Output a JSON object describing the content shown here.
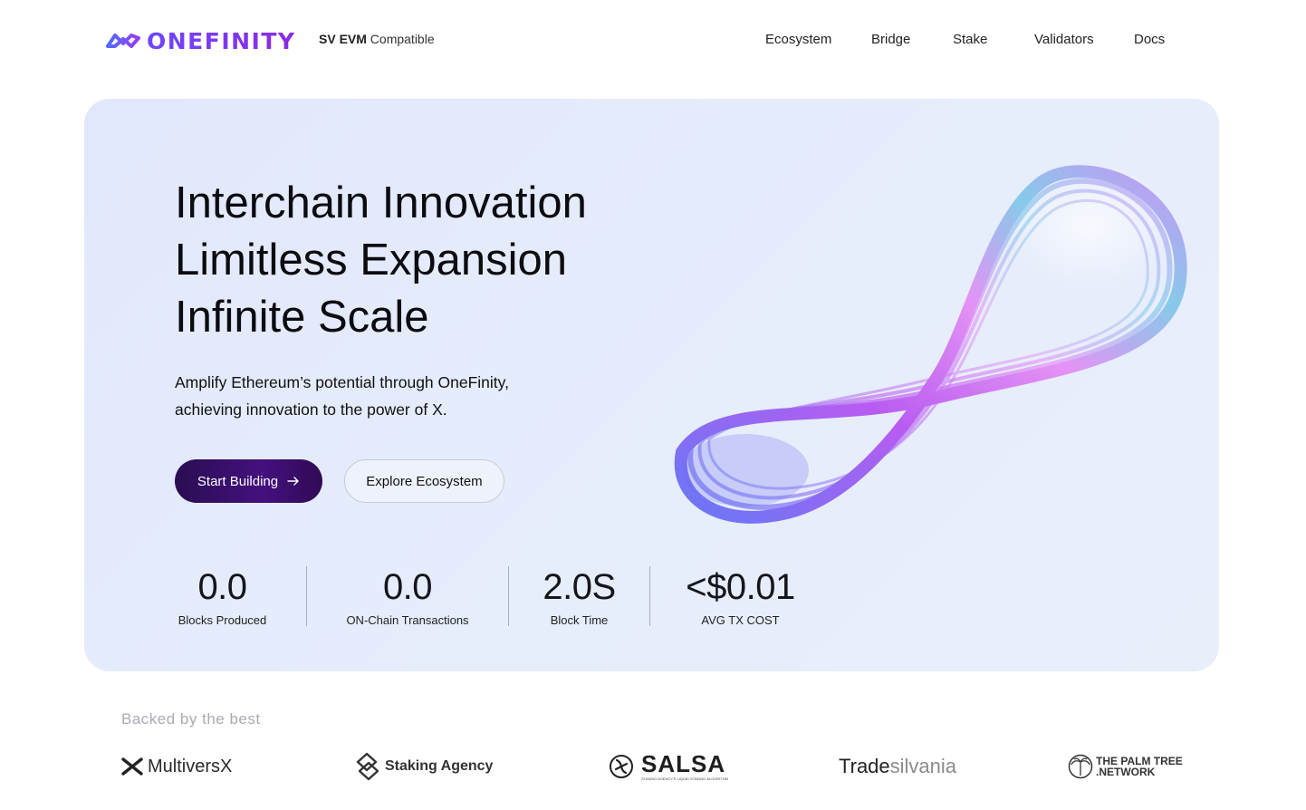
{
  "header": {
    "logo_text": "ONEFINITY",
    "tag_bold": "SV EVM",
    "tag_rest": "Compatible",
    "nav": [
      "Ecosystem",
      "Bridge",
      "Stake",
      "Validators",
      "Docs"
    ]
  },
  "hero": {
    "headline": [
      "Interchain Innovation",
      "Limitless Expansion",
      "Infinite Scale"
    ],
    "subtext_line1": "Amplify Ethereum’s potential through OneFinity,",
    "subtext_line2": "achieving innovation to the power of X.",
    "primary_button": "Start Building",
    "secondary_button": "Explore Ecosystem",
    "stats": [
      {
        "value": "0.0",
        "label": "Blocks Produced"
      },
      {
        "value": "0.0",
        "label": "ON-Chain Transactions"
      },
      {
        "value": "2.0S",
        "label": "Block Time"
      },
      {
        "value": "<$0.01",
        "label": "AVG TX COST"
      }
    ]
  },
  "backers": {
    "title": "Backed by the best",
    "partners": [
      {
        "name": "MultiversX",
        "icon": "multiversx-x-icon"
      },
      {
        "name": "Staking Agency",
        "icon": "staking-agency-icon"
      },
      {
        "name": "SALSA",
        "sub": "STAKING AGENCY'S LIQUID STAKING ALGORITHM",
        "icon": "salsa-icon"
      },
      {
        "name_a": "Trade",
        "name_b": "silvania"
      },
      {
        "name_line1": "THE PALM TREE",
        "name_line2": ".NETWORK",
        "icon": "palm-tree-icon"
      }
    ]
  },
  "colors": {
    "brand": "#6f46ff",
    "primary_button": "#2a0d52",
    "hero_bg": "#e4eafb"
  }
}
